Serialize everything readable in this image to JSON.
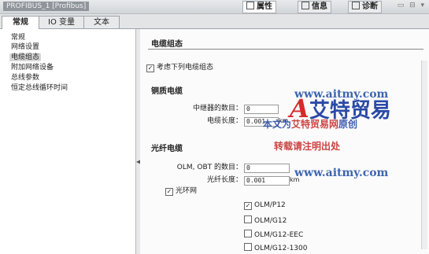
{
  "window": {
    "title": "PROFIBUS_1 [Profibus]"
  },
  "panel_tabs": [
    {
      "label": "属性",
      "icon": "properties-icon",
      "active": true
    },
    {
      "label": "信息",
      "icon": "info-icon",
      "active": false
    },
    {
      "label": "诊断",
      "icon": "diagnostics-icon",
      "active": false
    }
  ],
  "window_buttons": "▭ ⊟ ▾",
  "tabs": [
    {
      "label": "常规",
      "active": true
    },
    {
      "label": "IO 变量",
      "active": false
    },
    {
      "label": "文本",
      "active": false
    }
  ],
  "nav": {
    "items": [
      {
        "label": "常规",
        "selected": false
      },
      {
        "label": "网络设置",
        "selected": false
      },
      {
        "label": "电缆组态",
        "selected": true
      },
      {
        "label": "附加网络设备",
        "selected": false
      },
      {
        "label": "总线参数",
        "selected": false
      },
      {
        "label": "恒定总线循环时间",
        "selected": false
      }
    ]
  },
  "section": {
    "title": "电缆组态",
    "consider_cable_label": "考虑下列电缆组态",
    "consider_cable_checked": true,
    "copper": {
      "heading": "铜质电缆",
      "repeaters_label": "中继器的数目：",
      "repeaters_value": "0",
      "length_label": "电缆长度：",
      "length_value": "0.001",
      "length_unit": "km"
    },
    "fiber": {
      "heading": "光纤电缆",
      "olm_label": "OLM, OBT 的数目：",
      "olm_value": "0",
      "length_label": "光纤长度：",
      "length_value": "0.001",
      "length_unit": "km",
      "ring_label": "光环网",
      "ring_checked": true,
      "options": [
        {
          "label": "OLM/P12",
          "checked": true
        },
        {
          "label": "OLM/G12",
          "checked": false
        },
        {
          "label": "OLM/G12-EEC",
          "checked": false
        },
        {
          "label": "OLM/G12-1300",
          "checked": false
        }
      ]
    }
  },
  "watermark": {
    "logo_mark": "A",
    "logo_text": "艾特贸易",
    "url": "www.aitmy.com",
    "line1_a": "本文为",
    "line1_b": "艾特贸易网",
    "line1_c": "原创",
    "line2": "转载请注明出处"
  }
}
